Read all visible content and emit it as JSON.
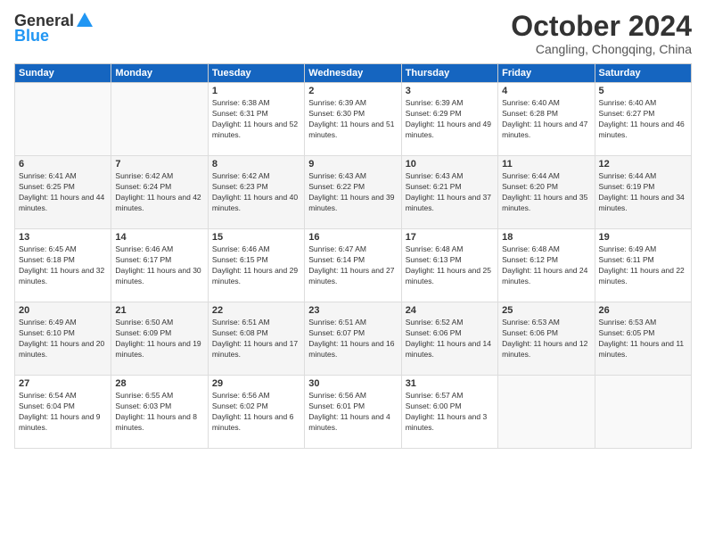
{
  "header": {
    "logo_general": "General",
    "logo_blue": "Blue",
    "month_title": "October 2024",
    "subtitle": "Cangling, Chongqing, China"
  },
  "weekdays": [
    "Sunday",
    "Monday",
    "Tuesday",
    "Wednesday",
    "Thursday",
    "Friday",
    "Saturday"
  ],
  "weeks": [
    [
      {
        "day": "",
        "sunrise": "",
        "sunset": "",
        "daylight": "",
        "empty": true
      },
      {
        "day": "",
        "sunrise": "",
        "sunset": "",
        "daylight": "",
        "empty": true
      },
      {
        "day": "1",
        "sunrise": "Sunrise: 6:38 AM",
        "sunset": "Sunset: 6:31 PM",
        "daylight": "Daylight: 11 hours and 52 minutes."
      },
      {
        "day": "2",
        "sunrise": "Sunrise: 6:39 AM",
        "sunset": "Sunset: 6:30 PM",
        "daylight": "Daylight: 11 hours and 51 minutes."
      },
      {
        "day": "3",
        "sunrise": "Sunrise: 6:39 AM",
        "sunset": "Sunset: 6:29 PM",
        "daylight": "Daylight: 11 hours and 49 minutes."
      },
      {
        "day": "4",
        "sunrise": "Sunrise: 6:40 AM",
        "sunset": "Sunset: 6:28 PM",
        "daylight": "Daylight: 11 hours and 47 minutes."
      },
      {
        "day": "5",
        "sunrise": "Sunrise: 6:40 AM",
        "sunset": "Sunset: 6:27 PM",
        "daylight": "Daylight: 11 hours and 46 minutes."
      }
    ],
    [
      {
        "day": "6",
        "sunrise": "Sunrise: 6:41 AM",
        "sunset": "Sunset: 6:25 PM",
        "daylight": "Daylight: 11 hours and 44 minutes."
      },
      {
        "day": "7",
        "sunrise": "Sunrise: 6:42 AM",
        "sunset": "Sunset: 6:24 PM",
        "daylight": "Daylight: 11 hours and 42 minutes."
      },
      {
        "day": "8",
        "sunrise": "Sunrise: 6:42 AM",
        "sunset": "Sunset: 6:23 PM",
        "daylight": "Daylight: 11 hours and 40 minutes."
      },
      {
        "day": "9",
        "sunrise": "Sunrise: 6:43 AM",
        "sunset": "Sunset: 6:22 PM",
        "daylight": "Daylight: 11 hours and 39 minutes."
      },
      {
        "day": "10",
        "sunrise": "Sunrise: 6:43 AM",
        "sunset": "Sunset: 6:21 PM",
        "daylight": "Daylight: 11 hours and 37 minutes."
      },
      {
        "day": "11",
        "sunrise": "Sunrise: 6:44 AM",
        "sunset": "Sunset: 6:20 PM",
        "daylight": "Daylight: 11 hours and 35 minutes."
      },
      {
        "day": "12",
        "sunrise": "Sunrise: 6:44 AM",
        "sunset": "Sunset: 6:19 PM",
        "daylight": "Daylight: 11 hours and 34 minutes."
      }
    ],
    [
      {
        "day": "13",
        "sunrise": "Sunrise: 6:45 AM",
        "sunset": "Sunset: 6:18 PM",
        "daylight": "Daylight: 11 hours and 32 minutes."
      },
      {
        "day": "14",
        "sunrise": "Sunrise: 6:46 AM",
        "sunset": "Sunset: 6:17 PM",
        "daylight": "Daylight: 11 hours and 30 minutes."
      },
      {
        "day": "15",
        "sunrise": "Sunrise: 6:46 AM",
        "sunset": "Sunset: 6:15 PM",
        "daylight": "Daylight: 11 hours and 29 minutes."
      },
      {
        "day": "16",
        "sunrise": "Sunrise: 6:47 AM",
        "sunset": "Sunset: 6:14 PM",
        "daylight": "Daylight: 11 hours and 27 minutes."
      },
      {
        "day": "17",
        "sunrise": "Sunrise: 6:48 AM",
        "sunset": "Sunset: 6:13 PM",
        "daylight": "Daylight: 11 hours and 25 minutes."
      },
      {
        "day": "18",
        "sunrise": "Sunrise: 6:48 AM",
        "sunset": "Sunset: 6:12 PM",
        "daylight": "Daylight: 11 hours and 24 minutes."
      },
      {
        "day": "19",
        "sunrise": "Sunrise: 6:49 AM",
        "sunset": "Sunset: 6:11 PM",
        "daylight": "Daylight: 11 hours and 22 minutes."
      }
    ],
    [
      {
        "day": "20",
        "sunrise": "Sunrise: 6:49 AM",
        "sunset": "Sunset: 6:10 PM",
        "daylight": "Daylight: 11 hours and 20 minutes."
      },
      {
        "day": "21",
        "sunrise": "Sunrise: 6:50 AM",
        "sunset": "Sunset: 6:09 PM",
        "daylight": "Daylight: 11 hours and 19 minutes."
      },
      {
        "day": "22",
        "sunrise": "Sunrise: 6:51 AM",
        "sunset": "Sunset: 6:08 PM",
        "daylight": "Daylight: 11 hours and 17 minutes."
      },
      {
        "day": "23",
        "sunrise": "Sunrise: 6:51 AM",
        "sunset": "Sunset: 6:07 PM",
        "daylight": "Daylight: 11 hours and 16 minutes."
      },
      {
        "day": "24",
        "sunrise": "Sunrise: 6:52 AM",
        "sunset": "Sunset: 6:06 PM",
        "daylight": "Daylight: 11 hours and 14 minutes."
      },
      {
        "day": "25",
        "sunrise": "Sunrise: 6:53 AM",
        "sunset": "Sunset: 6:06 PM",
        "daylight": "Daylight: 11 hours and 12 minutes."
      },
      {
        "day": "26",
        "sunrise": "Sunrise: 6:53 AM",
        "sunset": "Sunset: 6:05 PM",
        "daylight": "Daylight: 11 hours and 11 minutes."
      }
    ],
    [
      {
        "day": "27",
        "sunrise": "Sunrise: 6:54 AM",
        "sunset": "Sunset: 6:04 PM",
        "daylight": "Daylight: 11 hours and 9 minutes."
      },
      {
        "day": "28",
        "sunrise": "Sunrise: 6:55 AM",
        "sunset": "Sunset: 6:03 PM",
        "daylight": "Daylight: 11 hours and 8 minutes."
      },
      {
        "day": "29",
        "sunrise": "Sunrise: 6:56 AM",
        "sunset": "Sunset: 6:02 PM",
        "daylight": "Daylight: 11 hours and 6 minutes."
      },
      {
        "day": "30",
        "sunrise": "Sunrise: 6:56 AM",
        "sunset": "Sunset: 6:01 PM",
        "daylight": "Daylight: 11 hours and 4 minutes."
      },
      {
        "day": "31",
        "sunrise": "Sunrise: 6:57 AM",
        "sunset": "Sunset: 6:00 PM",
        "daylight": "Daylight: 11 hours and 3 minutes."
      },
      {
        "day": "",
        "sunrise": "",
        "sunset": "",
        "daylight": "",
        "empty": true
      },
      {
        "day": "",
        "sunrise": "",
        "sunset": "",
        "daylight": "",
        "empty": true
      }
    ]
  ]
}
